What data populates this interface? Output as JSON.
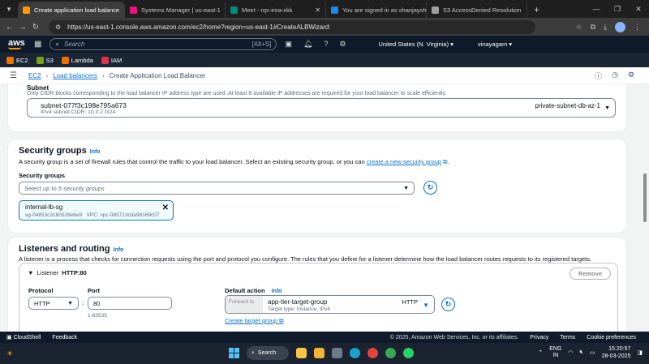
{
  "browser": {
    "tabs": [
      {
        "label": "Create application load balance",
        "color": "#ff9900",
        "active": true
      },
      {
        "label": "Systems Manager | us-east-1",
        "color": "#e7157b",
        "active": false
      },
      {
        "label": "Meet - rqx-iroa-xkk",
        "color": "#00897b",
        "active": false
      },
      {
        "label": "You are signed in as shanjaysh",
        "color": "#1e88e5",
        "active": false
      },
      {
        "label": "S3 AccessDenied Resolution",
        "color": "#9e9e9e",
        "active": false
      }
    ],
    "url": "https://us-east-1.console.aws.amazon.com/ec2/home?region=us-east-1#CreateALBWizard:"
  },
  "aws_nav": {
    "logo": "aws",
    "search_placeholder": "Search",
    "search_shortcut": "[Alt+S]",
    "region": "United States (N. Virginia) ▾",
    "user": "vinayagam ▾"
  },
  "favorites": [
    {
      "label": "EC2",
      "color": "#ed7100"
    },
    {
      "label": "S3",
      "color": "#7aa116"
    },
    {
      "label": "Lambda",
      "color": "#ed7100"
    },
    {
      "label": "IAM",
      "color": "#dd344c"
    }
  ],
  "breadcrumb": {
    "items": [
      "EC2",
      "Load balancers"
    ],
    "current": "Create Application Load Balancer"
  },
  "subnet": {
    "label": "Subnet",
    "description": "Only CIDR blocks corresponding to the load balancer IP address type are used. At least 8 available IP addresses are required for your load balancer to scale efficiently.",
    "selected_id": "subnet-077f3c198e795a673",
    "cidr": "IPv4 subnet CIDR: 10.0.2.0/24",
    "name": "private-subnet-db-az-1"
  },
  "security_groups": {
    "title": "Security groups",
    "info": "Info",
    "description_before": "A security group is a set of firewall rules that control the traffic to your load balancer. Select an existing security group, or you can ",
    "create_link": "create a new security group",
    "description_after": ".",
    "field_label": "Security groups",
    "placeholder": "Select up to 5 security groups",
    "selected": {
      "name": "internal-lb-sg",
      "id": "sg-04853c3180528e6e9",
      "vpc": "VPC: vpc-085713cda98169c07"
    }
  },
  "listeners": {
    "title": "Listeners and routing",
    "info": "Info",
    "description": "A listener is a process that checks for connection requests using the port and protocol you configure. The rules that you define for a listener determine how the load balancer routes requests to its registered targets.",
    "listener_label": "Listener",
    "listener_value": "HTTP:80",
    "remove_label": "Remove",
    "protocol_label": "Protocol",
    "protocol_value": "HTTP",
    "port_label": "Port",
    "port_value": "80",
    "port_hint": "1-65535",
    "default_action_label": "Default action",
    "default_action_info": "Info",
    "forward_to": "Forward to",
    "target_group": "app-tier-target-group",
    "target_type": "Target type: Instance, IPv4",
    "target_protocol": "HTTP",
    "create_target_group": "Create target group"
  },
  "footer": {
    "cloudshell": "CloudShell",
    "feedback": "Feedback",
    "copyright": "© 2025, Amazon Web Services, Inc. or its affiliates.",
    "privacy": "Privacy",
    "terms": "Terms",
    "cookies": "Cookie preferences"
  },
  "taskbar": {
    "search": "Search",
    "lang_top": "ENG",
    "lang_bottom": "IN",
    "time": "15:20:57",
    "date": "28-03-2025"
  }
}
